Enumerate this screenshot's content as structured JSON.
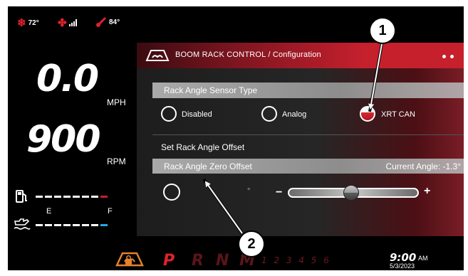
{
  "status": {
    "temp_left": "72°",
    "temp_right": "84°"
  },
  "speed": {
    "value": "0.0",
    "unit": "MPH"
  },
  "rpm": {
    "value": "900",
    "unit": "RPM"
  },
  "fuel_gauge": {
    "empty": "E",
    "full": "F"
  },
  "panel": {
    "title": "BOOM RACK CONTROL / Configuration",
    "sensor_type": {
      "label": "Rack Angle Sensor Type",
      "options": [
        "Disabled",
        "Analog",
        "XRT CAN"
      ],
      "selected": "XRT CAN"
    },
    "offset_label": "Set Rack Angle Offset",
    "zero_offset": {
      "label": "Rack Angle Zero Offset",
      "current_angle": "Current Angle: -1.3°",
      "degree_mark": "°",
      "minus": "−",
      "plus": "+"
    }
  },
  "bottom": {
    "gears": [
      "P",
      "R",
      "N",
      "M"
    ],
    "numbers": "1 2 3 4 5 6",
    "time": "9:00",
    "ampm": "AM",
    "date": "5/3/2023"
  },
  "callouts": [
    "1",
    "2"
  ],
  "colors": {
    "accent": "#c6202d",
    "blue": "#29a8e0",
    "orange": "#e6822c"
  }
}
